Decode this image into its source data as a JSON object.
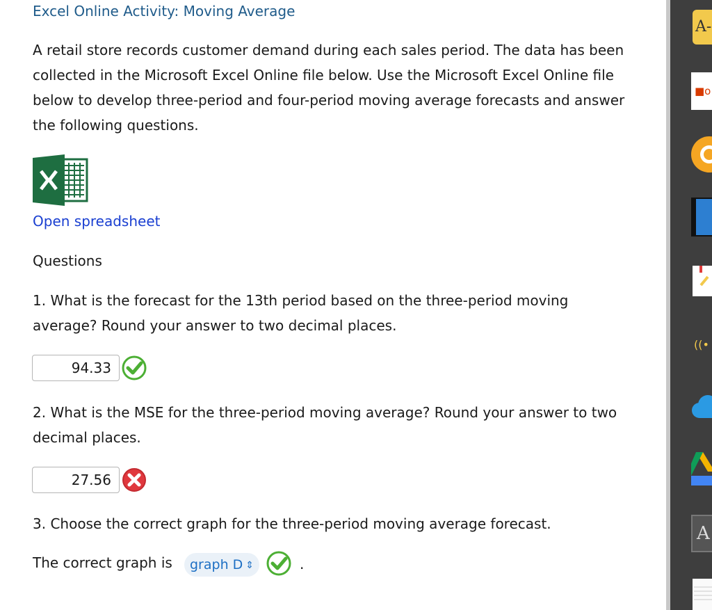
{
  "page": {
    "title": "Excel Online Activity: Moving Average",
    "intro": "A retail store records customer demand during each sales period. The data has been collected in the Microsoft Excel Online file below. Use the Microsoft Excel Online file below to develop three-period and four-period moving average forecasts and answer the following questions.",
    "open_spreadsheet_label": "Open spreadsheet",
    "questions_heading": "Questions"
  },
  "questions": [
    {
      "text": "1. What is the forecast for the 13th period based on the three-period moving average? Round your answer to two decimal places.",
      "answer": "94.33",
      "status": "correct"
    },
    {
      "text": "2. What is the MSE for the three-period moving average? Round your answer to two decimal places.",
      "answer": "27.56",
      "status": "incorrect"
    },
    {
      "text": "3. Choose the correct graph for the three-period moving average forecast.",
      "prefix": "The correct graph is",
      "selected": "graph D",
      "suffix": ".",
      "status": "correct"
    }
  ],
  "sidebar": {
    "first_label": "A-",
    "items": [
      "font-size-icon",
      "office-icon",
      "orange-circle-icon",
      "blue-book-icon",
      "notes-icon",
      "wireless-icon",
      "cloud-icon",
      "drive-icon",
      "acrobat-icon",
      "notepad-icon"
    ]
  },
  "colors": {
    "title": "#1f5b8a",
    "link": "#1a3fd1",
    "correct": "#4caf34",
    "incorrect": "#e0383e",
    "select_text": "#1d6fc4",
    "sidebar": "#3e3e3e"
  }
}
